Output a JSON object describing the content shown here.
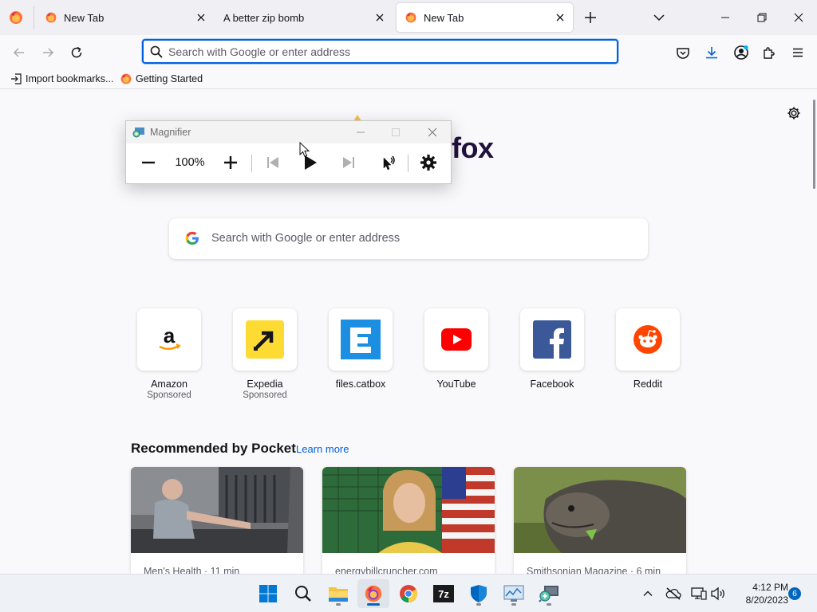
{
  "browser": {
    "tabs": [
      {
        "title": "New Tab",
        "active": false
      },
      {
        "title": "A better zip bomb",
        "active": false
      },
      {
        "title": "New Tab",
        "active": true
      }
    ],
    "url_placeholder": "Search with Google or enter address"
  },
  "bookmarks": [
    {
      "label": "Import bookmarks...",
      "icon": "import-icon"
    },
    {
      "label": "Getting Started",
      "icon": "firefox-icon"
    }
  ],
  "newtab": {
    "wordmark": "fox",
    "search_placeholder": "Search with Google or enter address",
    "top_sites": [
      {
        "label": "Amazon",
        "sponsor": "Sponsored",
        "icon": "amazon-icon"
      },
      {
        "label": "Expedia",
        "sponsor": "Sponsored",
        "icon": "expedia-icon"
      },
      {
        "label": "files.catbox",
        "sponsor": "",
        "icon": "catbox-icon"
      },
      {
        "label": "YouTube",
        "sponsor": "",
        "icon": "youtube-icon"
      },
      {
        "label": "Facebook",
        "sponsor": "",
        "icon": "facebook-icon"
      },
      {
        "label": "Reddit",
        "sponsor": "",
        "icon": "reddit-icon"
      }
    ],
    "pocket": {
      "title": "Recommended by Pocket",
      "learn_more": "Learn more",
      "cards": [
        {
          "source": "Men's Health · 11 min"
        },
        {
          "source": "energybillcruncher.com"
        },
        {
          "source": "Smithsonian Magazine · 6 min"
        }
      ]
    }
  },
  "magnifier": {
    "title": "Magnifier",
    "zoom": "100%"
  },
  "taskbar": {
    "time": "4:12 PM",
    "date": "8/20/2023",
    "notifications": "6",
    "apps": [
      "start-icon",
      "search-icon",
      "file-explorer-icon",
      "firefox-icon",
      "chrome-icon",
      "7zip-icon",
      "defender-icon",
      "resource-monitor-icon",
      "magnifier-icon"
    ]
  },
  "colors": {
    "accent": "#0061e0",
    "windows_accent": "#0067c0"
  }
}
